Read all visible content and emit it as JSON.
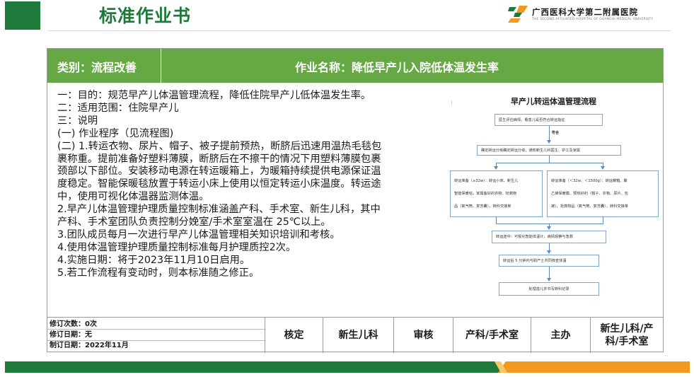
{
  "page": {
    "title": "标准作业书"
  },
  "hospital": {
    "name": "广西医科大学第二附属医院",
    "subname": "THE SECOND AFFILIATED HOSPITAL OF GUANGXI MEDICAL UNIVERSITY",
    "logo_icon": "hospital-logo",
    "colors": {
      "green": "#1e7a3a",
      "orange": "#f29a1f"
    }
  },
  "header": {
    "category": "类别：流程改善",
    "operation_name": "作业名称：降低早产儿入院低体温发生率",
    "band_color": "#65a844"
  },
  "content": {
    "lines": [
      "一：目的：规范早产儿体温管理流程，降低住院早产儿低体温发生率。",
      "二：适用范围：住院早产儿",
      "三：说明",
      "(一) 作业程序（见流程图)",
      "(二) 1.转运衣物、尿片、帽子、被子提前预热，断脐后迅速用温热毛毯包",
      "裹称重。提前准备好塑料薄膜，断脐后在不擦干的情况下用塑料薄膜包裹",
      "颈部以下部位。安装移动电源在转运暖箱上，为暖箱持续提供电源保证温",
      "度稳定。智能保暖毯放置于转运小床上使用以恒定转运小床温度。转运途",
      "中，使用可视化体温器监测体温。",
      "2.早产儿体温管理护理质量控制标准涵盖产科、手术室、新生儿科，其中",
      "产科、手术室团队负责控制分娩室/手术室室温在 25℃以上。",
      "3.团队成员每月一次进行早产儿体温管理相关知识培训和考核。",
      "4.使用体温管理护理质量控制标准每月护理质控2次。",
      "4.实施日期：将于2023年11月10日启用。",
      "5.若工作流程有变动时，则本标准随之修正。"
    ]
  },
  "flowchart": {
    "title": "早产儿转运体温管理流程",
    "step1": "医生评估病情，看患儿是否符合转运指征",
    "condition": "符合",
    "step2": "确定转运分级确定转运分级，通知新生儿科医生、护工及家属",
    "left_branch": [
      "转运准备（≥32w）：转运小床、新生儿",
      "智能保暖毯，家属备好的衣物、抢救物",
      "品（氧气筒、复苏囊），转科交接单"
    ],
    "right_branch": [
      "转运准备（＜32w、＜1500g）：转运暖箱、聚",
      "乙烯保暖膜、预热好的（帽子、衣物、尿片、包",
      "被）、抢救物品（氧气筒、复苏囊），转科交接单"
    ],
    "step3": "转运途中：可视化智能体温计，病情观察与急救",
    "step4": "转运后 5 分钟内与助产士共同核查体温",
    "step5": "处理患儿并书写转科记录"
  },
  "footer": {
    "revision_count": "修订次数：0次",
    "revision_date": "修订日期：无",
    "created_date": "制订日期：2022年11月",
    "cells": [
      "核定",
      "新生儿科",
      "审核",
      "产科/手术室",
      "主办",
      "新生儿科/产科/手术室"
    ]
  }
}
